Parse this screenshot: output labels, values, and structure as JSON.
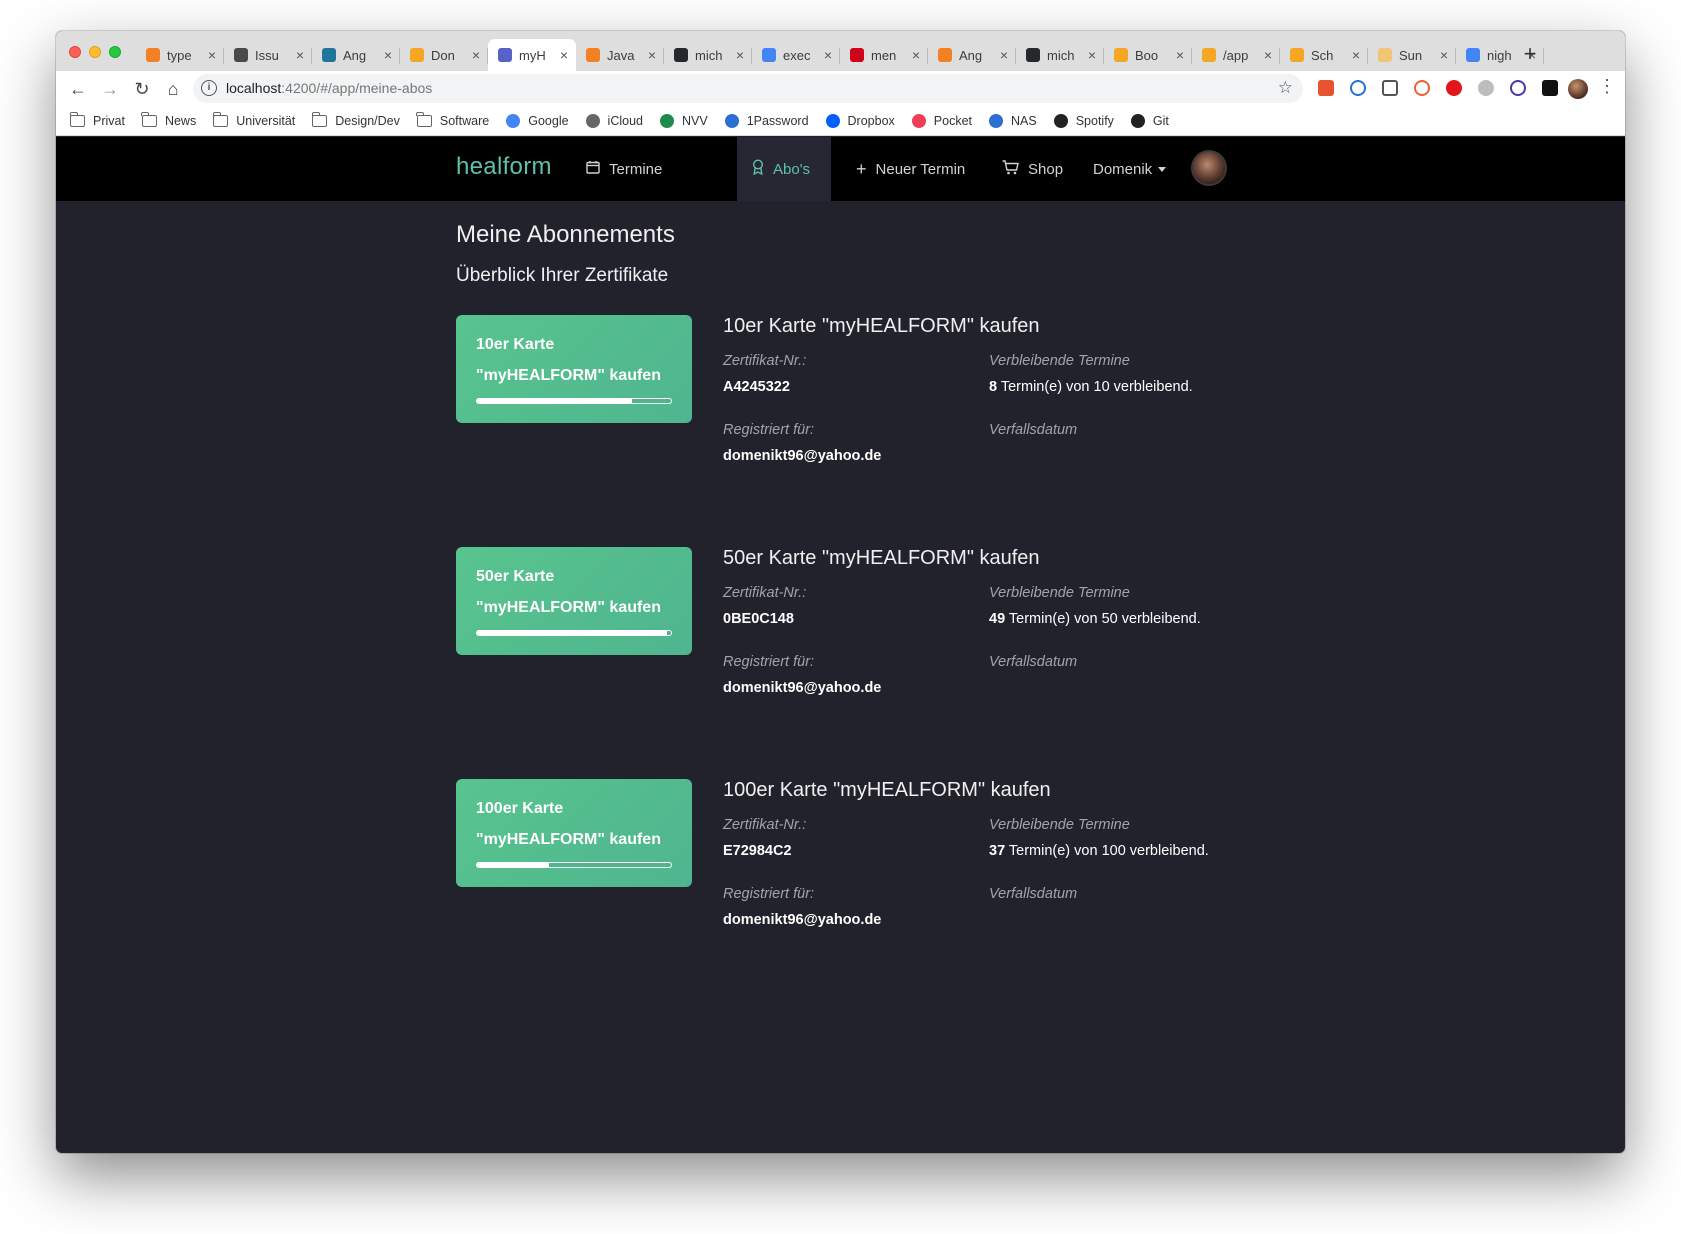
{
  "browser": {
    "tabs": [
      {
        "title": "type",
        "color": "#f48024"
      },
      {
        "title": "Issu",
        "color": "#4a4a4a"
      },
      {
        "title": "Ang",
        "color": "#21759b"
      },
      {
        "title": "Don",
        "color": "#f5a623"
      },
      {
        "title": "myH",
        "color": "#5562c9",
        "active": true
      },
      {
        "title": "Java",
        "color": "#f48024"
      },
      {
        "title": "mich",
        "color": "#24292e"
      },
      {
        "title": "exec",
        "color": "#4285f4"
      },
      {
        "title": "men",
        "color": "#d0021b"
      },
      {
        "title": "Ang",
        "color": "#f48024"
      },
      {
        "title": "mich",
        "color": "#24292e"
      },
      {
        "title": "Boo",
        "color": "#f5a623"
      },
      {
        "title": "/app",
        "color": "#f5a623"
      },
      {
        "title": "Sch",
        "color": "#f5a623"
      },
      {
        "title": "Sun",
        "color": "#f0c674"
      },
      {
        "title": "nigh",
        "color": "#4285f4"
      }
    ],
    "close_glyph": "×",
    "new_tab_glyph": "+",
    "url_host": "localhost",
    "url_path": ":4200/#/app/meine-abos",
    "bookmarks": [
      {
        "label": "Privat",
        "icon": "folder-icon"
      },
      {
        "label": "News",
        "icon": "folder-icon"
      },
      {
        "label": "Universität",
        "icon": "folder-icon"
      },
      {
        "label": "Design/Dev",
        "icon": "folder-icon"
      },
      {
        "label": "Software",
        "icon": "folder-icon"
      },
      {
        "label": "Google",
        "icon": "google-icon"
      },
      {
        "label": "iCloud",
        "icon": "apple-icon"
      },
      {
        "label": "NVV",
        "icon": "nvv-icon"
      },
      {
        "label": "1Password",
        "icon": "onepassword-icon"
      },
      {
        "label": "Dropbox",
        "icon": "dropbox-icon"
      },
      {
        "label": "Pocket",
        "icon": "pocket-icon"
      },
      {
        "label": "NAS",
        "icon": "nas-icon"
      },
      {
        "label": "Spotify",
        "icon": "spotify-icon"
      },
      {
        "label": "Git",
        "icon": "github-icon"
      }
    ]
  },
  "nav": {
    "brand": "healform",
    "termine": "Termine",
    "abos": "Abo's",
    "neuer_termin": "Neuer Termin",
    "shop": "Shop",
    "user": "Domenik"
  },
  "colors": {
    "accent": "#5ec1a8",
    "card": "#58c48e",
    "background": "#21222c"
  },
  "page": {
    "title": "Meine Abonnements",
    "subtitle": "Überblick Ihrer Zertifikate",
    "label_cert_nr": "Zertifikat-Nr.:",
    "label_remaining": "Verbleibende Termine",
    "label_registered": "Registriert für:",
    "label_expiry": "Verfallsdatum"
  },
  "certificates": [
    {
      "card_line1": "10er Karte",
      "card_line2": "\"myHEALFORM\" kaufen",
      "heading": "10er Karte \"myHEALFORM\" kaufen",
      "cert_nr": "A4245322",
      "remaining": "8",
      "remaining_text": " Termin(e) von 10 verbleibend.",
      "registered_for": "domenikt96@yahoo.de",
      "progress": 0.8
    },
    {
      "card_line1": "50er Karte",
      "card_line2": "\"myHEALFORM\" kaufen",
      "heading": "50er Karte \"myHEALFORM\" kaufen",
      "cert_nr": "0BE0C148",
      "remaining": "49",
      "remaining_text": " Termin(e) von 50 verbleibend.",
      "registered_for": "domenikt96@yahoo.de",
      "progress": 0.98
    },
    {
      "card_line1": "100er Karte",
      "card_line2": "\"myHEALFORM\" kaufen",
      "heading": "100er Karte \"myHEALFORM\" kaufen",
      "cert_nr": "E72984C2",
      "remaining": "37",
      "remaining_text": " Termin(e) von 100 verbleibend.",
      "registered_for": "domenikt96@yahoo.de",
      "progress": 0.37
    }
  ]
}
